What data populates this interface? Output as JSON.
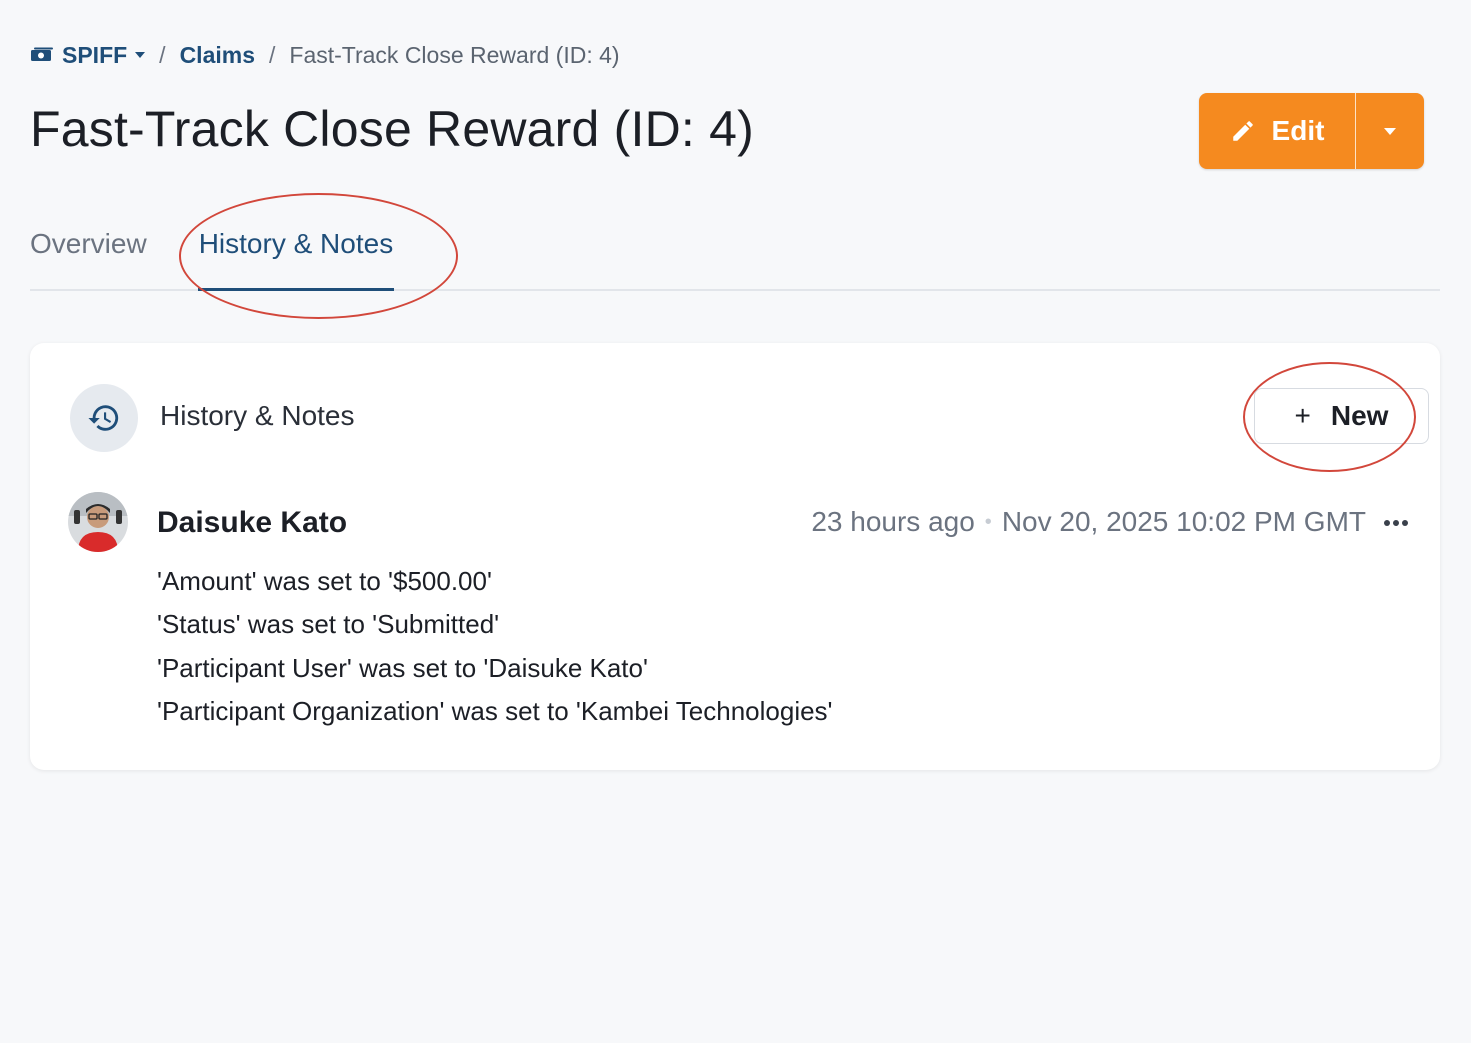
{
  "breadcrumb": {
    "root_label": "SPIFF",
    "section_label": "Claims",
    "current_label": "Fast-Track Close Reward (ID: 4)",
    "separator": "/"
  },
  "header": {
    "title": "Fast-Track Close Reward (ID: 4)",
    "edit_label": "Edit"
  },
  "tabs": [
    {
      "label": "Overview",
      "active": false
    },
    {
      "label": "History & Notes",
      "active": true
    }
  ],
  "panel": {
    "title": "History & Notes",
    "new_label": "New",
    "new_icon": "+"
  },
  "entries": [
    {
      "author": "Daisuke Kato",
      "relative_time": "23 hours ago",
      "separator": "•",
      "timestamp": "Nov 20, 2025 10:02 PM GMT",
      "changes": [
        "'Amount' was set to '$500.00'",
        "'Status' was set to 'Submitted'",
        "'Participant User' was set to 'Daisuke Kato'",
        "'Participant Organization' was set to 'Kambei Technologies'"
      ]
    }
  ],
  "colors": {
    "accent": "#f58a1f",
    "link": "#1f4e79",
    "annotation": "#d2473b"
  },
  "icons": [
    "money-icon",
    "chevron-down-icon",
    "pencil-icon",
    "history-icon",
    "plus-icon",
    "more-horizontal-icon"
  ]
}
